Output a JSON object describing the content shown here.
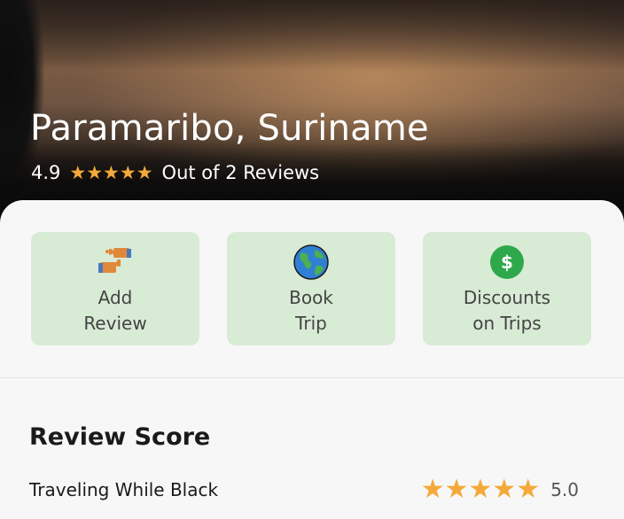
{
  "hero": {
    "title": "Paramaribo, Suriname",
    "rating": "4.9",
    "stars": "★★★★★",
    "reviews_text": "Out of 2 Reviews"
  },
  "actions": [
    {
      "icon": "thumbs-icon",
      "line1": "Add",
      "line2": "Review"
    },
    {
      "icon": "globe-icon",
      "line1": "Book",
      "line2": "Trip"
    },
    {
      "icon": "dollar-icon",
      "line1": "Discounts",
      "line2": "on Trips"
    }
  ],
  "review_score": {
    "title": "Review Score",
    "rows": [
      {
        "label": "Traveling While Black",
        "stars": "★★★★★",
        "value": "5.0"
      }
    ]
  },
  "colors": {
    "star": "#f4a93a",
    "action_bg": "#d8ebd5",
    "dollar_green": "#2ea84a"
  }
}
